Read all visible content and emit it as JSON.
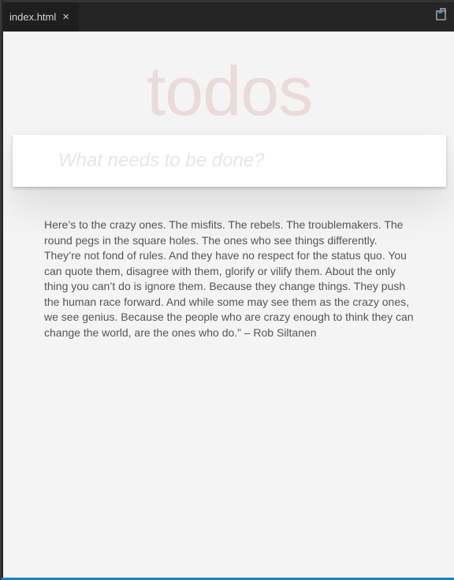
{
  "tab": {
    "filename": "index.html",
    "close_glyph": "×",
    "action_icon": "open-preview-icon"
  },
  "app": {
    "title": "todos",
    "new_todo_placeholder": "What needs to be done?",
    "new_todo_value": ""
  },
  "quote": {
    "text": "Here’s to the crazy ones. The misfits. The rebels. The troublemakers. The round pegs in the square holes. The ones who see things differently. They’re not fond of rules. And they have no respect for the status quo. You can quote them, disagree with them, glorify or vilify them. About the only thing you can’t do is ignore them. Because they change things. They push the human race forward. And while some may see them as the crazy ones, we see genius. Because the people who are crazy enough to think they can change the world, are the ones who do.” – Rob Siltanen"
  },
  "colors": {
    "title": "#af2f2f",
    "accent_bar": "#1e7fc4",
    "editor_bg": "#1e1e1e",
    "preview_bg": "#f4f4f4"
  }
}
